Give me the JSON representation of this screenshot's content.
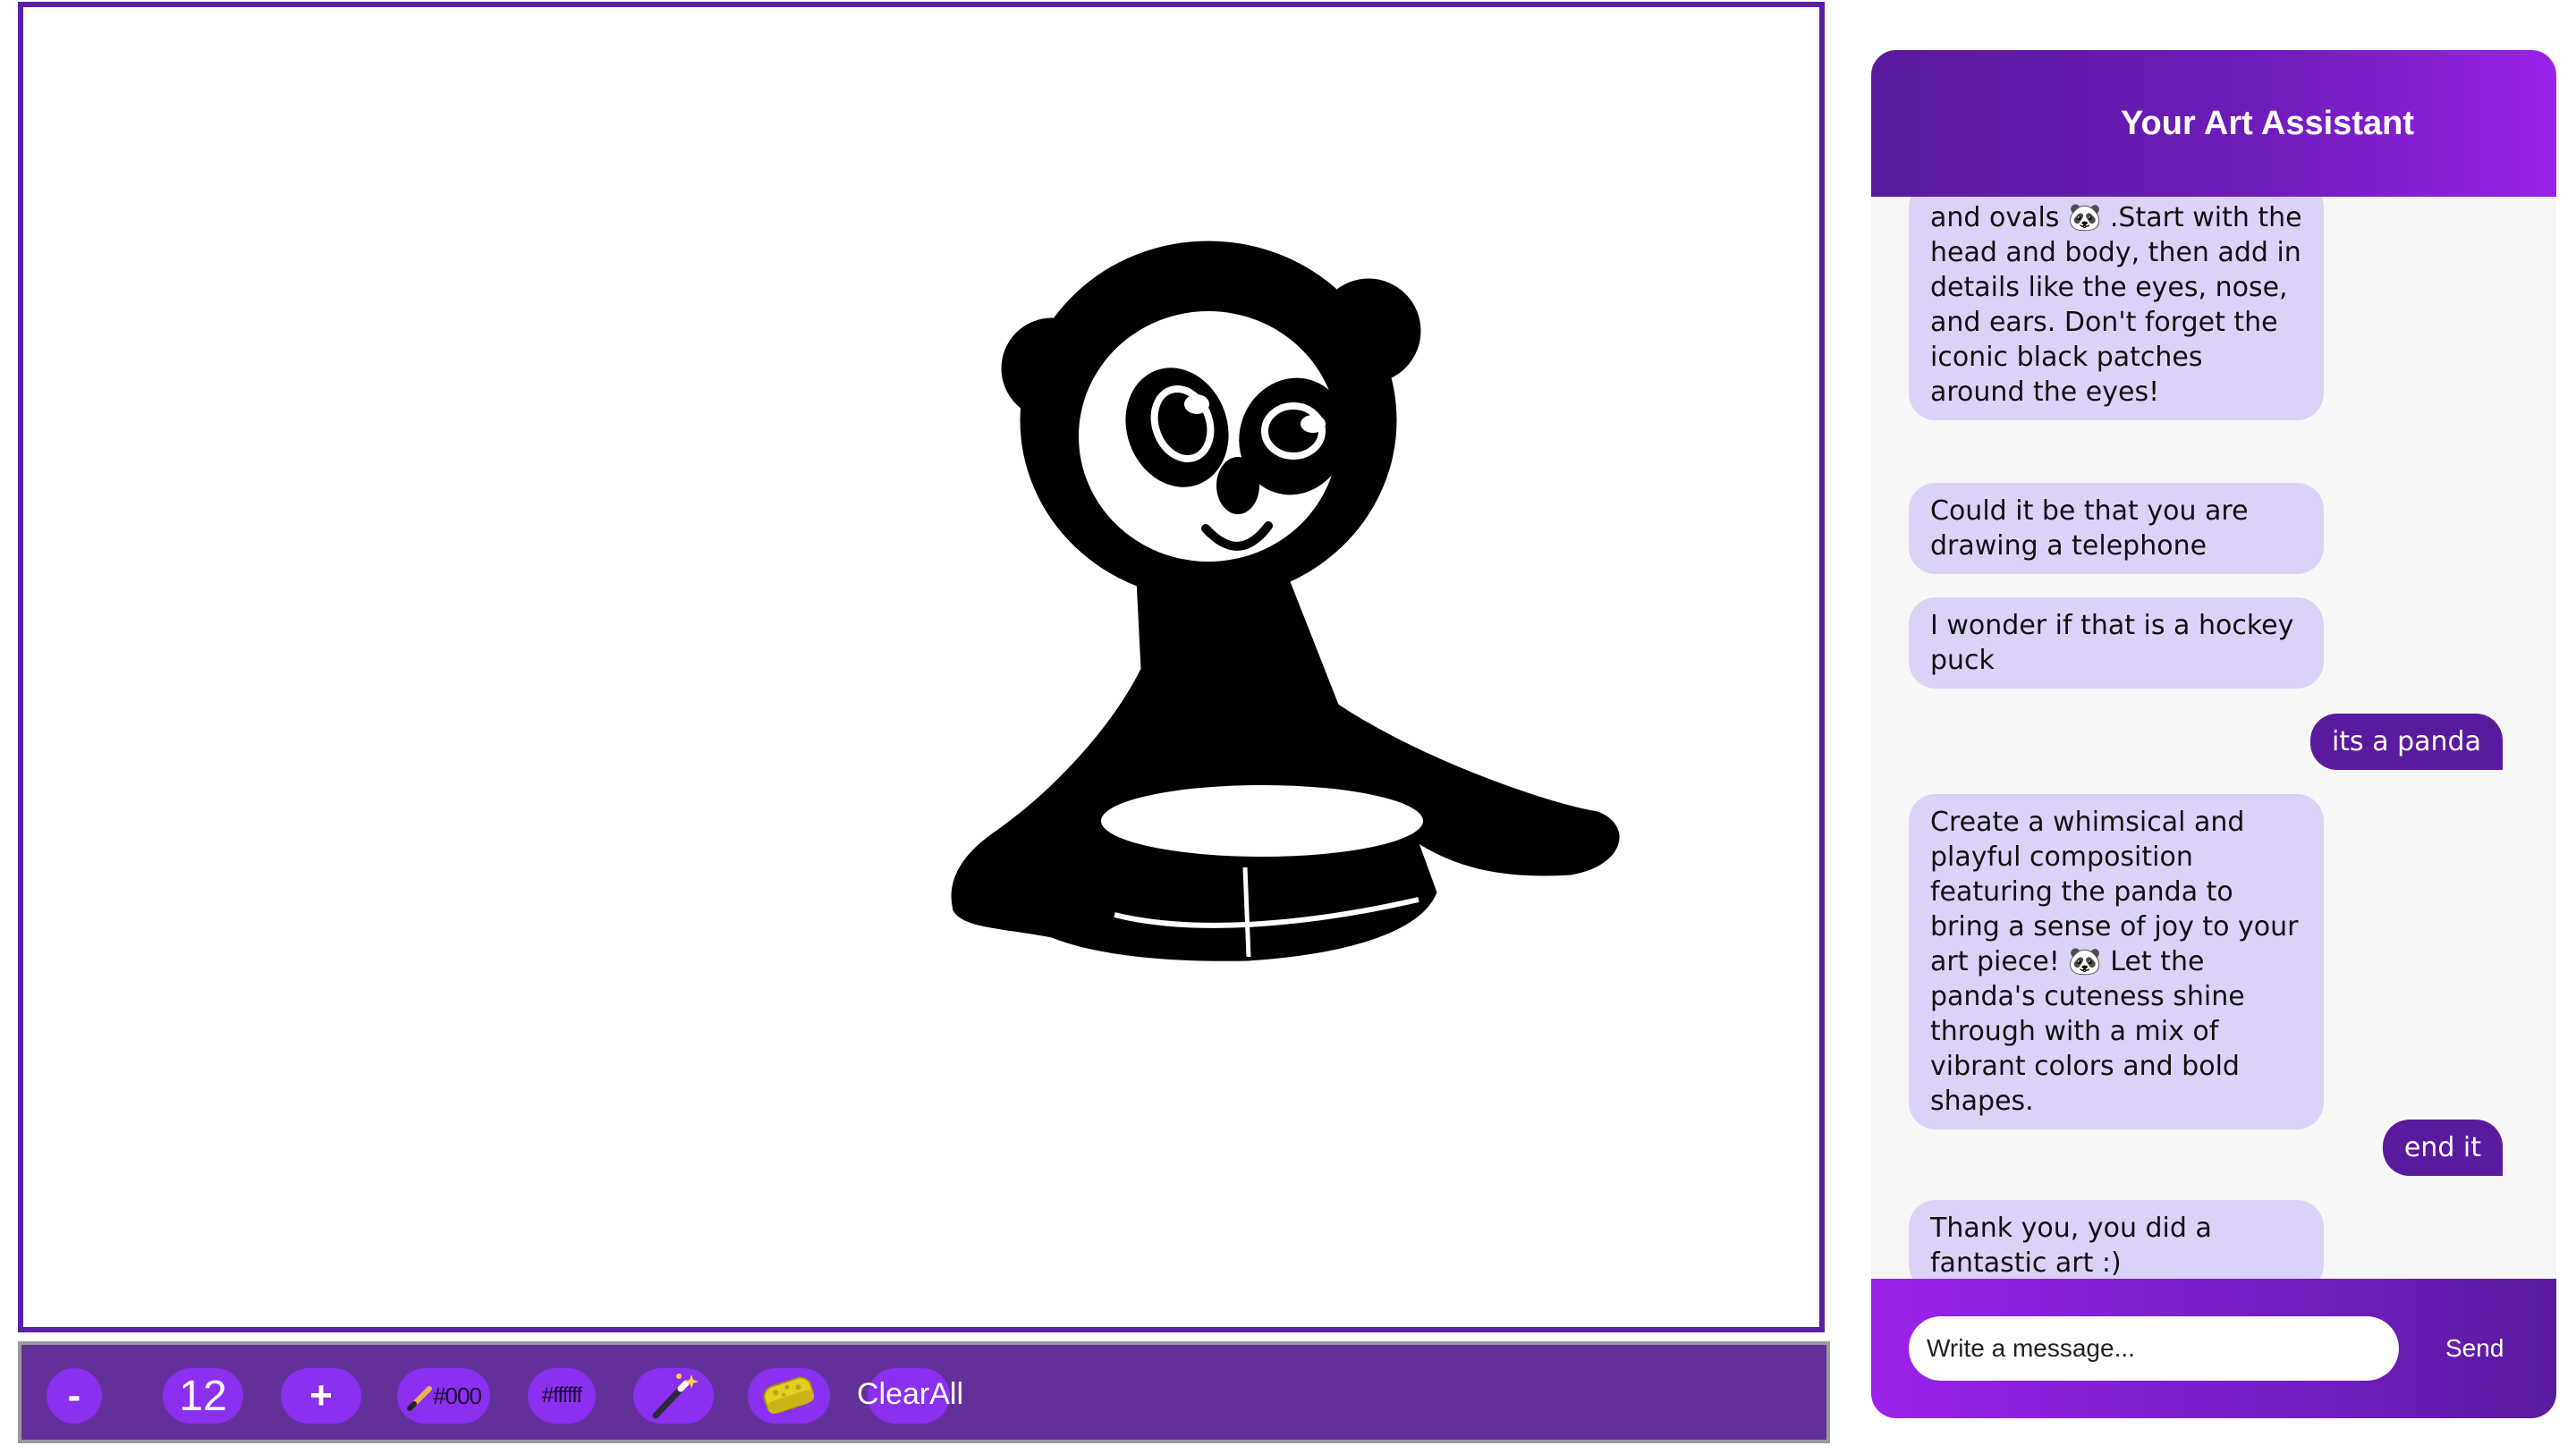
{
  "toolbar": {
    "decrease_label": "-",
    "brush_size": "12",
    "increase_label": "+",
    "pen_color_label": "#000",
    "background_color_label": "#ffffff",
    "clear_label": "ClearAll",
    "icons": [
      "pencil-icon",
      "magic-wand-icon",
      "sponge-icon"
    ]
  },
  "chat": {
    "title": "Your Art Assistant",
    "messages": [
      {
        "sender": "bot",
        "text": "and ovals 🐼 .Start with the head and body, then add in details like the eyes, nose, and ears. Don't forget the iconic black patches around the eyes!"
      },
      {
        "sender": "bot",
        "text": "Could it be that you are drawing a telephone"
      },
      {
        "sender": "bot",
        "text": "I wonder if that is a hockey puck"
      },
      {
        "sender": "user",
        "text": "its a panda"
      },
      {
        "sender": "bot",
        "text": "Create a whimsical and playful composition featuring the panda to bring a sense of joy to your art piece! 🐼 Let the panda's cuteness shine through with a mix of vibrant colors and bold shapes."
      },
      {
        "sender": "user",
        "text": "end it"
      },
      {
        "sender": "bot",
        "text": "Thank you, you did a fantastic art :)"
      }
    ],
    "input_placeholder": "Write a message...",
    "send_label": "Send"
  },
  "colors": {
    "accent": "#8b2ff0",
    "toolbar_bg": "#63319a",
    "header_start": "#5a1a9e",
    "header_end": "#9a22e8",
    "bot_bubble": "#dcd2f8",
    "user_bubble": "#5a1a9e",
    "canvas_border": "#5b1ea6"
  }
}
